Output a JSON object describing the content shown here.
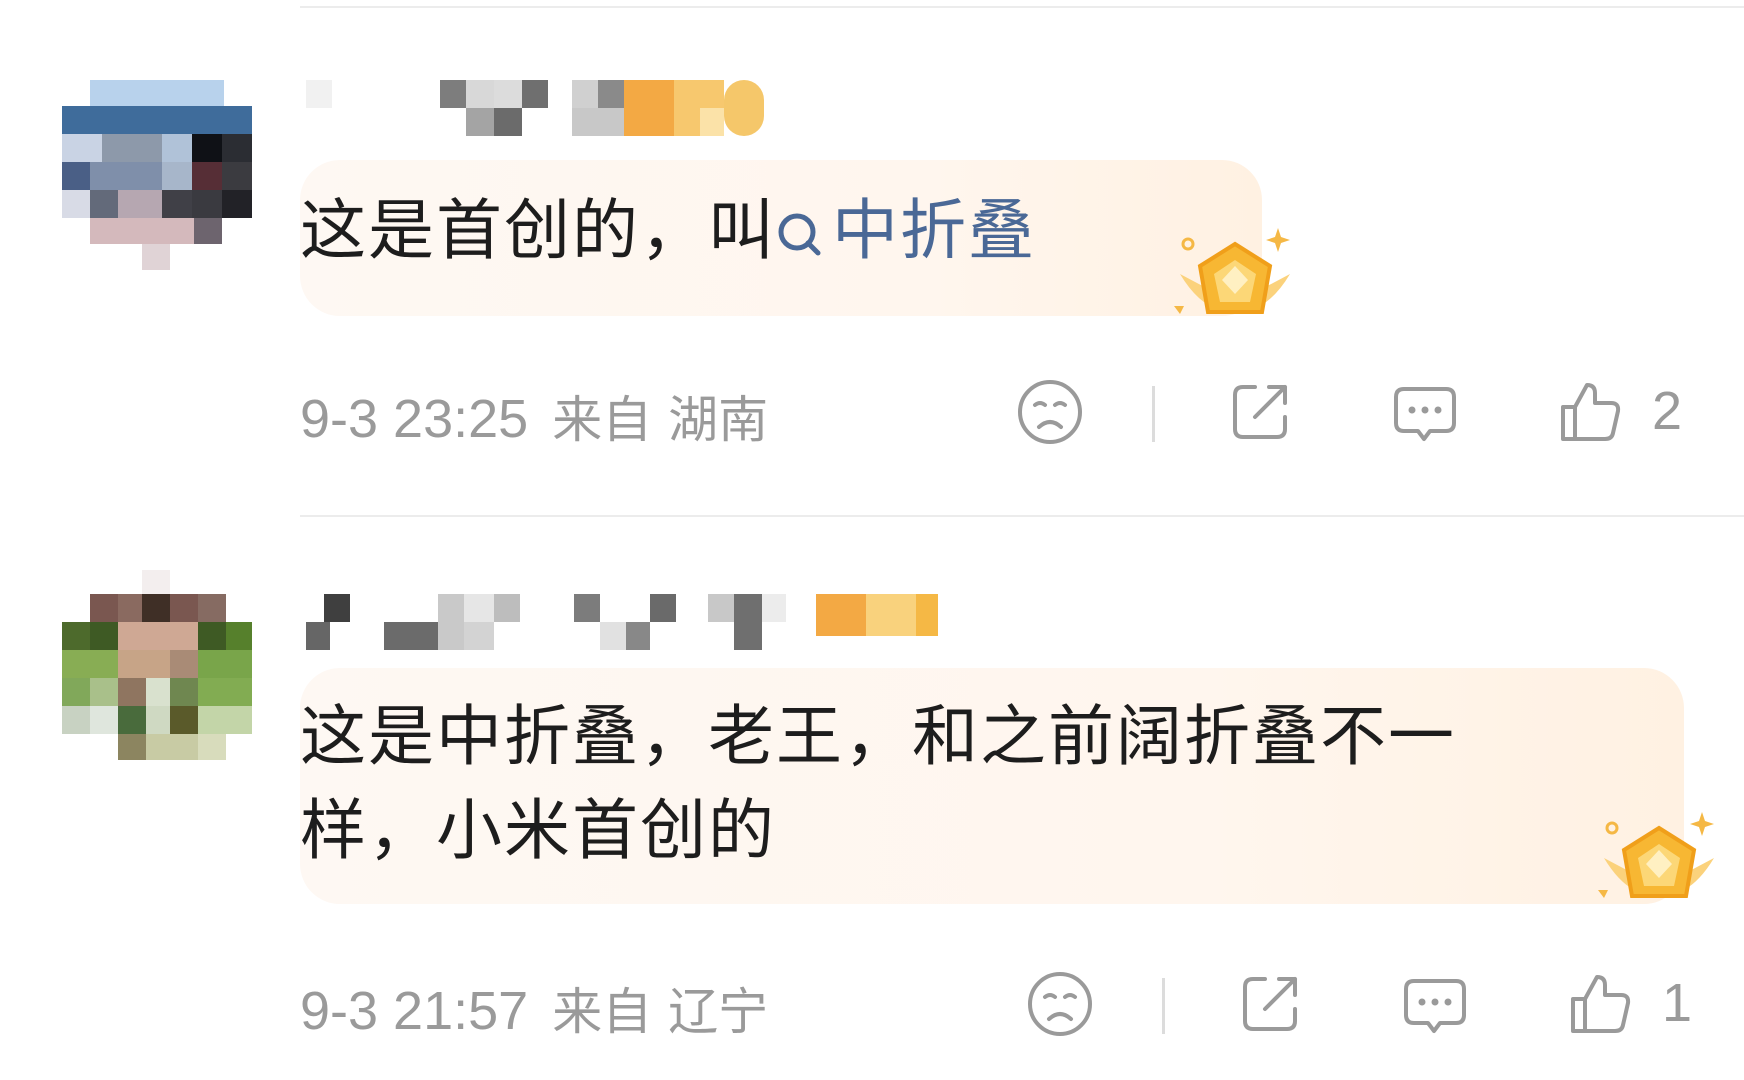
{
  "comments": [
    {
      "text_plain": "这是首创的，叫",
      "topic": "中折叠",
      "time": "9-3 23:25",
      "location": "来自 湖南",
      "likes": "2",
      "badge_icon": "gold-medal-icon"
    },
    {
      "text_line1": "这是中折叠，老王，和之前阔折叠不一",
      "text_line2": "样，小米首创的",
      "time": "9-3 21:57",
      "location": "来自 辽宁",
      "likes": "1",
      "badge_icon": "gold-medal-icon"
    }
  ],
  "colors": {
    "topic_link": "#4a6896",
    "meta": "#9a9a9a",
    "text": "#1d1d1d",
    "bubble": "#fff6ee",
    "badge_gold": "#f7b733"
  },
  "icons": [
    "search-icon",
    "dislike-face-icon",
    "share-icon",
    "reply-icon",
    "thumbs-up-icon",
    "gold-medal-icon"
  ]
}
